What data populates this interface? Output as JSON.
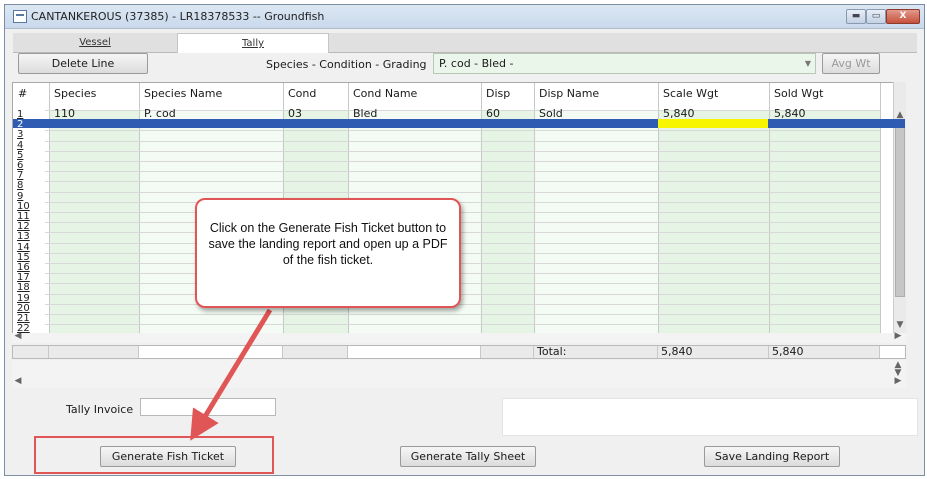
{
  "window": {
    "title": "CANTANKEROUS (37385) - LR18378533 -- Groundfish",
    "min_label": "▬",
    "max_label": "▭",
    "close_label": "X"
  },
  "tabs": [
    {
      "label": "Vessel",
      "active": false
    },
    {
      "label": "Tally",
      "active": true
    }
  ],
  "toolbar": {
    "delete_line": "Delete Line",
    "species_label": "Species - Condition - Grading",
    "species_value": "P. cod - Bled -",
    "avg_wt": "Avg Wt"
  },
  "grid": {
    "columns": [
      "#",
      "Species",
      "Species Name",
      "Cond",
      "Cond Name",
      "Disp",
      "Disp Name",
      "Scale Wgt",
      "Sold Wgt"
    ],
    "rows": [
      [
        "1",
        "110",
        "P. cod",
        "03",
        "Bled",
        "60",
        "Sold",
        "5,840",
        "5,840"
      ]
    ],
    "row_numbers": [
      "1",
      "2",
      "3",
      "4",
      "5",
      "6",
      "7",
      "8",
      "9",
      "10",
      "11",
      "12",
      "13",
      "14",
      "15",
      "16",
      "17",
      "18",
      "19",
      "20",
      "21",
      "22"
    ],
    "selected_row": 2
  },
  "totals": {
    "label": "Total:",
    "scale_wgt": "5,840",
    "sold_wgt": "5,840"
  },
  "form": {
    "tally_invoice_label": "Tally Invoice",
    "tally_invoice_value": ""
  },
  "buttons": {
    "generate_fish_ticket": "Generate Fish Ticket",
    "generate_tally_sheet": "Generate Tally Sheet",
    "save_landing_report": "Save Landing Report"
  },
  "annotation": {
    "callout_text": "Click on the Generate Fish Ticket button to save the landing report and open up a PDF of the fish ticket.",
    "color": "#e05555"
  }
}
